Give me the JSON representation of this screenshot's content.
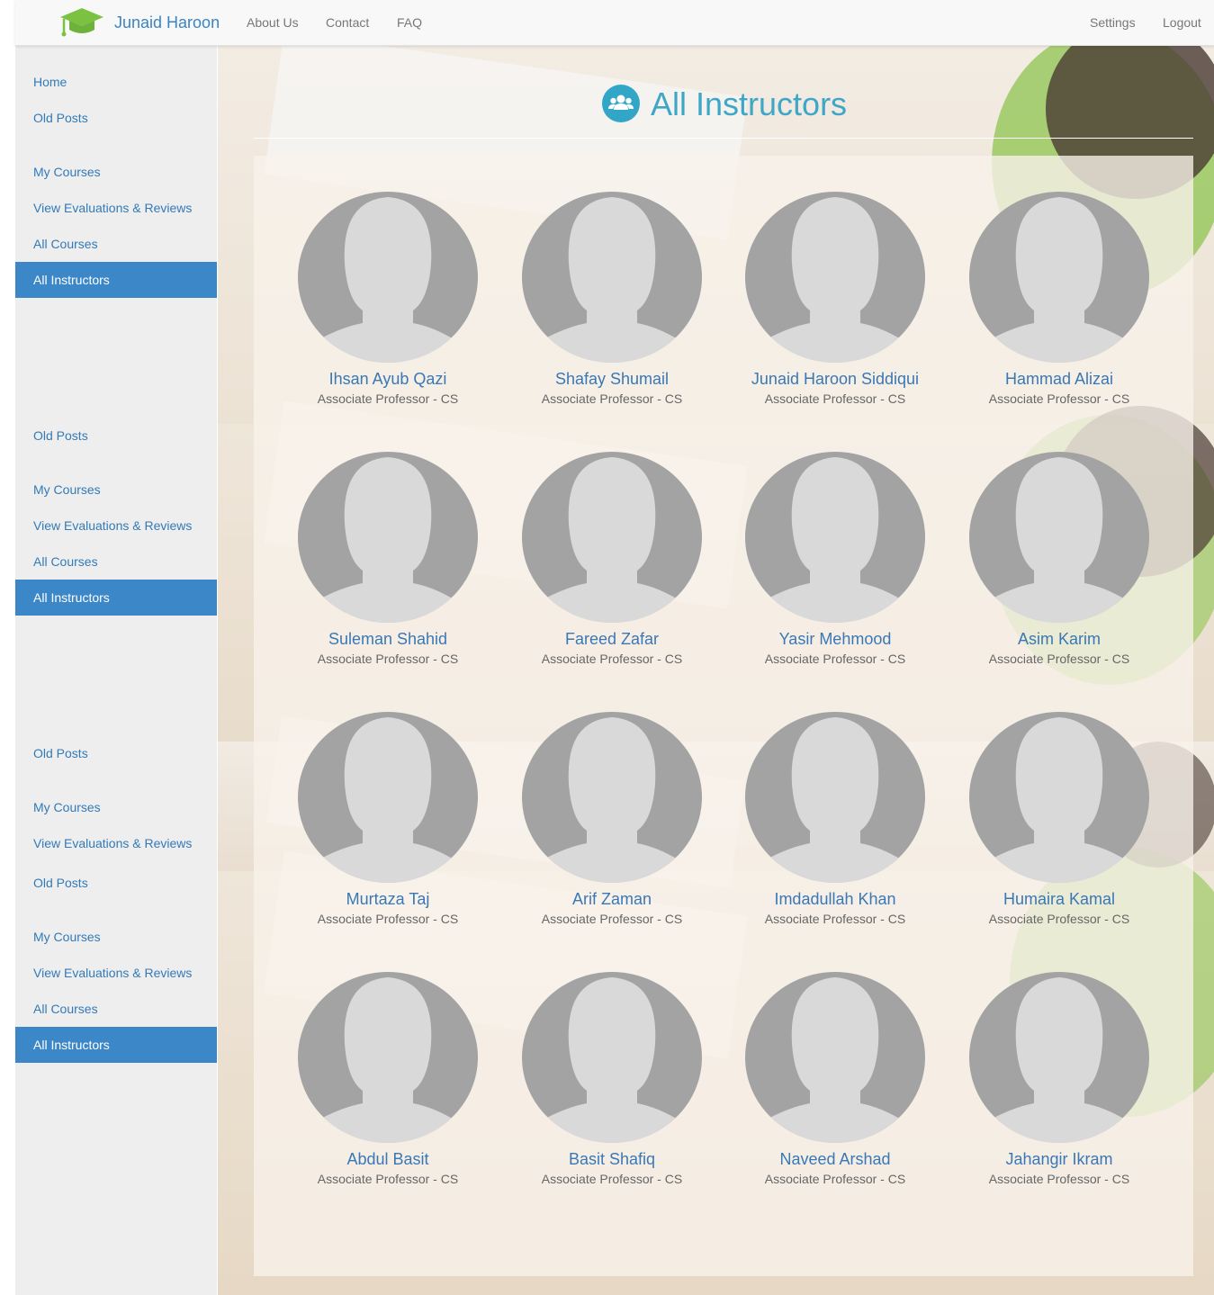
{
  "navbar": {
    "brand": "Junaid Haroon",
    "links": [
      "About Us",
      "Contact",
      "FAQ"
    ],
    "right_links": [
      "Settings",
      "Logout"
    ]
  },
  "sidebar": {
    "items": [
      {
        "label": "Home",
        "active": false
      },
      {
        "label": "Old Posts",
        "active": false
      },
      {
        "label": "My Courses",
        "active": false
      },
      {
        "label": "View Evaluations & Reviews",
        "active": false
      },
      {
        "label": "All Courses",
        "active": false
      },
      {
        "label": "All Instructors",
        "active": true
      },
      {
        "label": "Old Posts",
        "active": false
      },
      {
        "label": "My Courses",
        "active": false
      },
      {
        "label": "View Evaluations & Reviews",
        "active": false
      },
      {
        "label": "All Courses",
        "active": false
      },
      {
        "label": "All Instructors",
        "active": true
      },
      {
        "label": "Old Posts",
        "active": false
      },
      {
        "label": "My Courses",
        "active": false
      },
      {
        "label": "View Evaluations & Reviews",
        "active": false
      },
      {
        "label": "Old Posts",
        "active": false
      },
      {
        "label": "My Courses",
        "active": false
      },
      {
        "label": "View Evaluations & Reviews",
        "active": false
      },
      {
        "label": "All Courses",
        "active": false
      },
      {
        "label": "All Instructors",
        "active": true
      }
    ]
  },
  "page": {
    "title": "All Instructors",
    "icon": "users-icon"
  },
  "colors": {
    "accent": "#3ea7c7",
    "link": "#337ab7",
    "active_bg": "#3b87c8",
    "avatar_dark": "#a3a3a3",
    "avatar_light": "#d9d9d9"
  },
  "instructors": [
    {
      "name": "Ihsan Ayub Qazi",
      "title": "Associate Professor - CS"
    },
    {
      "name": "Shafay Shumail",
      "title": "Associate Professor - CS"
    },
    {
      "name": "Junaid Haroon Siddiqui",
      "title": "Associate Professor - CS"
    },
    {
      "name": "Hammad Alizai",
      "title": "Associate Professor - CS"
    },
    {
      "name": "Suleman Shahid",
      "title": "Associate Professor - CS"
    },
    {
      "name": "Fareed Zafar",
      "title": "Associate Professor - CS"
    },
    {
      "name": "Yasir Mehmood",
      "title": "Associate Professor - CS"
    },
    {
      "name": "Asim Karim",
      "title": "Associate Professor - CS"
    },
    {
      "name": "Murtaza Taj",
      "title": "Associate Professor - CS"
    },
    {
      "name": "Arif Zaman",
      "title": "Associate Professor - CS"
    },
    {
      "name": "Imdadullah Khan",
      "title": "Associate Professor - CS"
    },
    {
      "name": "Humaira Kamal",
      "title": "Associate Professor - CS"
    },
    {
      "name": "Abdul Basit",
      "title": "Associate Professor - CS"
    },
    {
      "name": "Basit Shafiq",
      "title": "Associate Professor - CS"
    },
    {
      "name": "Naveed Arshad",
      "title": "Associate Professor - CS"
    },
    {
      "name": "Jahangir Ikram",
      "title": "Associate Professor - CS"
    }
  ]
}
